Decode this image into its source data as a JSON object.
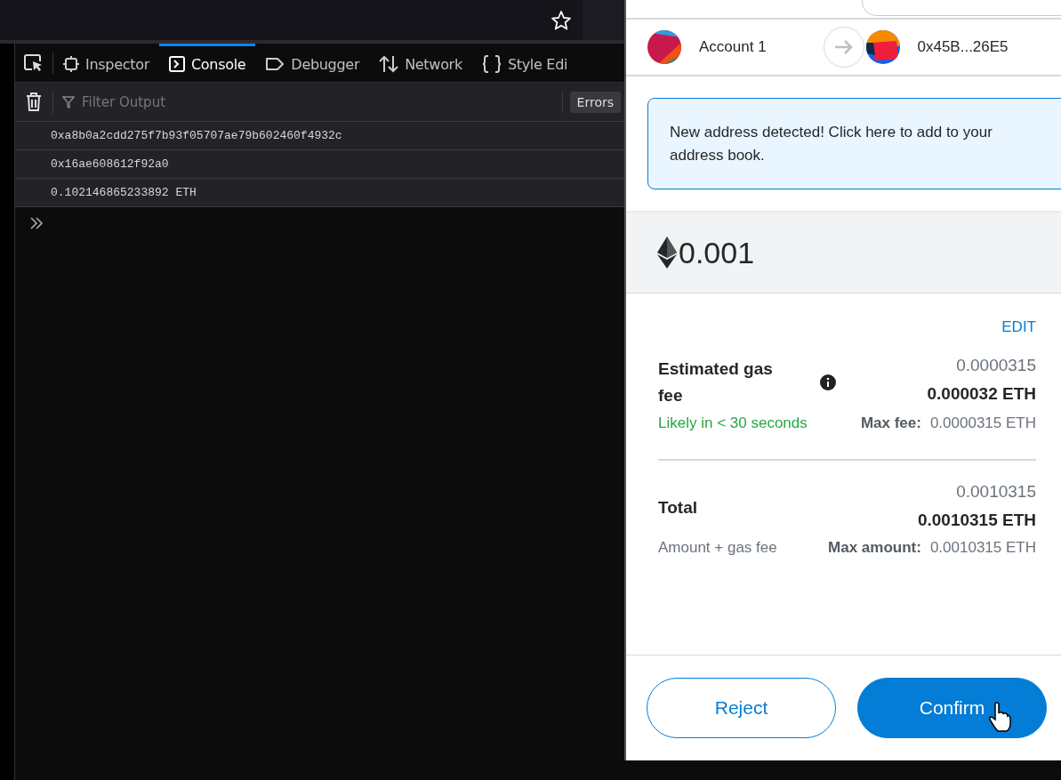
{
  "devtools": {
    "tabs": [
      {
        "label": "Inspector",
        "kind": "inspector",
        "selected": false
      },
      {
        "label": "Console",
        "kind": "console",
        "selected": true
      },
      {
        "label": "Debugger",
        "kind": "debugger",
        "selected": false
      },
      {
        "label": "Network",
        "kind": "network",
        "selected": false
      },
      {
        "label": "Style Edi",
        "kind": "style",
        "selected": false
      }
    ],
    "filter": {
      "placeholder": "Filter Output"
    },
    "filter_buttons": [
      "Errors"
    ],
    "log": [
      "0xa8b0a2cdd275f7b93f05707ae79b602460f4932c",
      "0x16ae608612f92a0",
      "0.102146865233892 ETH"
    ]
  },
  "popup": {
    "from_account": "Account 1",
    "to_address": "0x45B...26E5",
    "notice": "New address detected! Click here to add to your address book.",
    "amount": "0.001",
    "edit": "EDIT",
    "rows": [
      {
        "label": "Estimated gas fee",
        "info": true,
        "value": "0.0000315",
        "value_bold": "0.000032 ETH",
        "hint": "Likely in < 30 seconds",
        "kind": "success",
        "max_label": "Max fee:",
        "max_value": "0.0000315 ETH"
      },
      {
        "label": "Total",
        "info": false,
        "value": "0.0010315",
        "value_bold": "0.0010315 ETH",
        "hint": "Amount + gas fee",
        "kind": "muted",
        "max_label": "Max amount:",
        "max_value": "0.0010315 ETH"
      }
    ],
    "buttons": [
      {
        "label": "Reject",
        "kind": "secondary"
      },
      {
        "label": "Confirm",
        "kind": "primary"
      }
    ]
  }
}
